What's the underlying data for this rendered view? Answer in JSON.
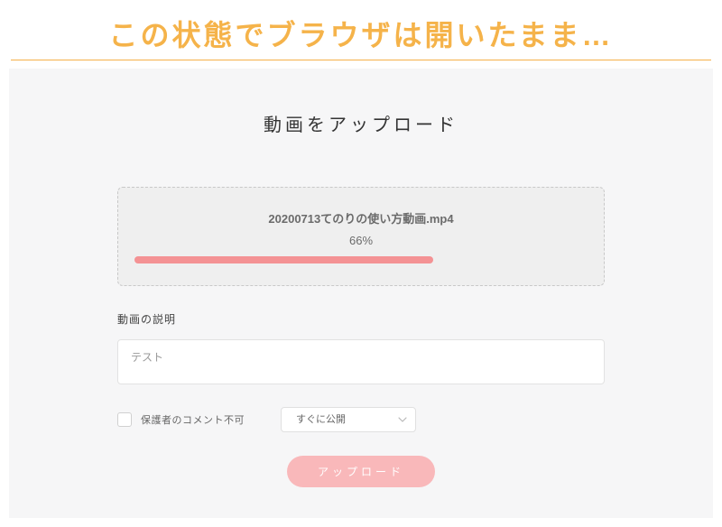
{
  "annotation": {
    "headline": "この状態でブラウザは開いたまま…"
  },
  "main": {
    "title": "動画をアップロード",
    "upload": {
      "file_name": "20200713てのりの使い方動画.mp4",
      "progress_label": "66%",
      "progress_value": 66
    },
    "description": {
      "section_label": "動画の説明",
      "value": "テスト"
    },
    "options": {
      "comments_checkbox_label": "保護者のコメント不可",
      "comments_disabled_checked": false,
      "publish_select_value": "すぐに公開"
    },
    "submit_label": "アップロード"
  },
  "colors": {
    "accent_orange": "#f5b04a",
    "accent_pink": "#f49294",
    "button_pink": "#f9b8ba"
  }
}
